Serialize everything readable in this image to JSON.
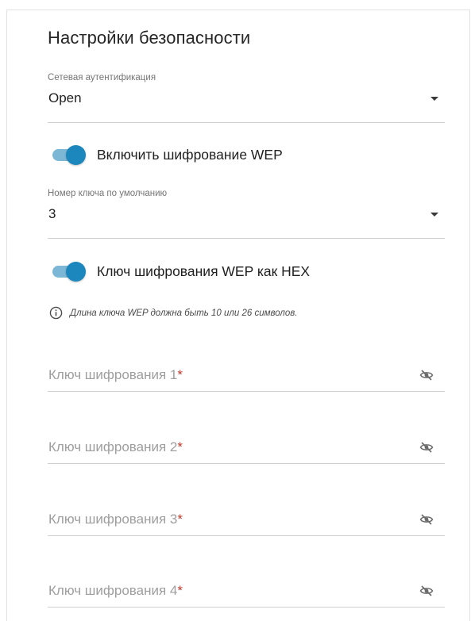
{
  "section": {
    "title": "Настройки безопасности"
  },
  "auth": {
    "label": "Сетевая аутентификация",
    "value": "Open"
  },
  "wep_toggle": {
    "label": "Включить шифрование WEP",
    "enabled": true
  },
  "default_key": {
    "label": "Номер ключа по умолчанию",
    "value": "3"
  },
  "hex_toggle": {
    "label": "Ключ шифрования WEP как HEX",
    "enabled": true
  },
  "hint": {
    "text": "Длина ключа WEP должна быть 10 или 26 символов.",
    "icon": "info-icon"
  },
  "keys": [
    {
      "placeholder": "Ключ шифрования 1",
      "required_mark": "*",
      "icon": "eye-off-icon"
    },
    {
      "placeholder": "Ключ шифрования 2",
      "required_mark": "*",
      "icon": "eye-off-icon"
    },
    {
      "placeholder": "Ключ шифрования 3",
      "required_mark": "*",
      "icon": "eye-off-icon"
    },
    {
      "placeholder": "Ключ шифрования 4",
      "required_mark": "*",
      "icon": "eye-off-icon"
    }
  ],
  "colors": {
    "accent": "#1b87bd",
    "accent_light": "#7db7d6",
    "required": "#c0392b"
  }
}
